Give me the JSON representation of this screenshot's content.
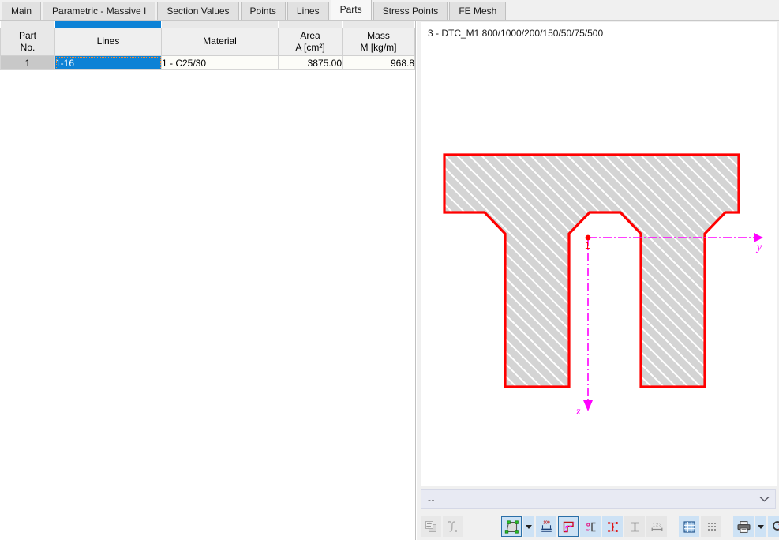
{
  "tabs": [
    {
      "label": "Main",
      "active": false
    },
    {
      "label": "Parametric - Massive I",
      "active": false
    },
    {
      "label": "Section Values",
      "active": false
    },
    {
      "label": "Points",
      "active": false
    },
    {
      "label": "Lines",
      "active": false
    },
    {
      "label": "Parts",
      "active": true
    },
    {
      "label": "Stress Points",
      "active": false
    },
    {
      "label": "FE Mesh",
      "active": false
    }
  ],
  "table": {
    "columns": [
      {
        "line1": "Part",
        "line2": "No."
      },
      {
        "line1": "",
        "line2": "Lines"
      },
      {
        "line1": "",
        "line2": "Material"
      },
      {
        "line1": "Area",
        "line2": "A [cm²]"
      },
      {
        "line1": "Mass",
        "line2": "M [kg/m]"
      }
    ],
    "rows": [
      {
        "part_no": "1",
        "lines": "1-16",
        "material": "1 - C25/30",
        "area": "3875.00",
        "mass": "968.8"
      }
    ]
  },
  "viewport": {
    "title": "3 - DTC_M1 800/1000/200/150/50/75/500",
    "axis_y_label": "y",
    "axis_z_label": "z",
    "origin_label": "1",
    "colors": {
      "outline": "#ff0000",
      "fill": "#d4d4d4",
      "hatch": "#ffffff",
      "axis": "#ff00ff",
      "background": "#ffffff"
    }
  },
  "combo": {
    "value": "--",
    "placeholder": "--"
  },
  "toolbar": {
    "buttons": [
      {
        "name": "transfer-section-icon",
        "state": "disabled"
      },
      {
        "name": "section-curve-icon",
        "state": "disabled"
      },
      {
        "name": "render-solid-icon",
        "state": "checked"
      },
      {
        "name": "render-dropdown-arrow",
        "state": "on"
      },
      {
        "name": "dimensions-icon",
        "state": "on"
      },
      {
        "name": "coordinate-system-icon",
        "state": "checked"
      },
      {
        "name": "shear-center-icon",
        "state": "on"
      },
      {
        "name": "stress-points-icon",
        "state": "on"
      },
      {
        "name": "section-outline-icon",
        "state": "plain"
      },
      {
        "name": "numbering-icon",
        "state": "plain"
      },
      {
        "name": "fe-mesh-grid-icon",
        "state": "on"
      },
      {
        "name": "point-grid-icon",
        "state": "plain"
      },
      {
        "name": "print-icon",
        "state": "on"
      },
      {
        "name": "print-dropdown-arrow",
        "state": "on"
      },
      {
        "name": "reset-zoom-icon",
        "state": "on"
      }
    ]
  }
}
